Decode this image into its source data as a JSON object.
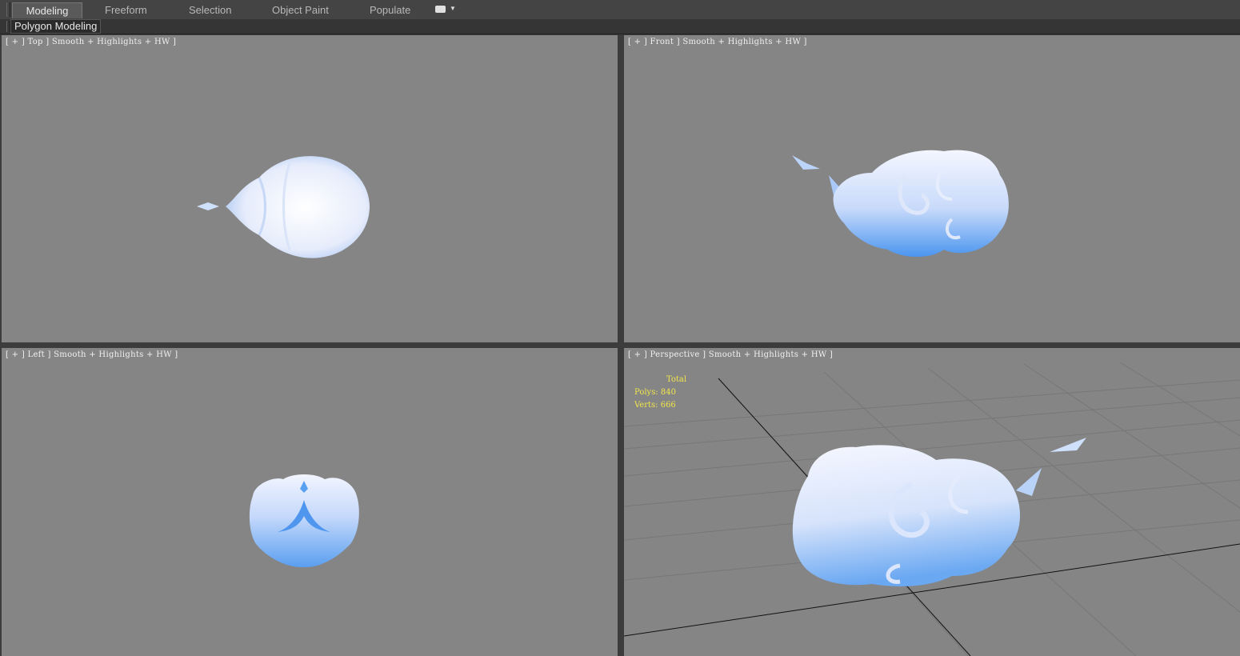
{
  "ribbon": {
    "tabs": [
      "Modeling",
      "Freeform",
      "Selection",
      "Object Paint",
      "Populate"
    ],
    "active_tab": "Modeling",
    "panel_label": "Polygon Modeling"
  },
  "viewports": {
    "top": {
      "label": "[ + ] Top ] Smooth + Highlights + HW ]"
    },
    "front": {
      "label": "[ + ] Front ] Smooth + Highlights + HW ]"
    },
    "left": {
      "label": "[ + ] Left ] Smooth + Highlights + HW ]"
    },
    "perspective": {
      "label": "[ + ] Perspective ] Smooth + Highlights + HW ]",
      "stats": {
        "title": "Total",
        "polys": "Polys: 840",
        "verts": "Verts: 666"
      }
    }
  },
  "colors": {
    "viewport_bg": "#858585",
    "stats_text": "#f1e54c",
    "cloud_light": "#f2f5ff",
    "cloud_dark": "#4d96ef"
  }
}
